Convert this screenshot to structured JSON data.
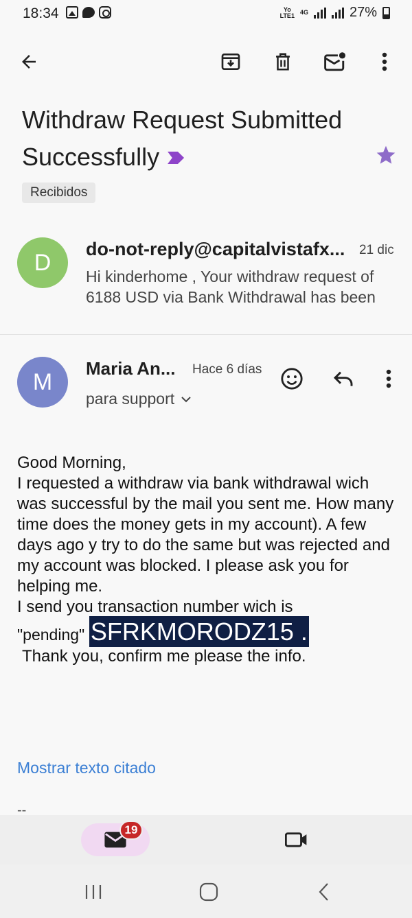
{
  "status_bar": {
    "time": "18:34",
    "network_top": "Yo",
    "network_bottom": "LTE1",
    "network_type": "4G",
    "battery": "27%",
    "notification_icons": [
      "photo-icon",
      "chat-icon",
      "instagram-icon"
    ]
  },
  "toolbar": {
    "icons": [
      "back-arrow-icon",
      "archive-icon",
      "trash-icon",
      "mark-unread-icon",
      "more-vert-icon"
    ]
  },
  "email": {
    "subject": "Withdraw Request Submitted Successfully",
    "label": "Recibidos",
    "starred": true,
    "star_color": "#8e6cc9",
    "important_color": "#8e44c9"
  },
  "message1": {
    "avatar_letter": "D",
    "avatar_color": "#8fc86a",
    "sender": "do-not-reply@capitalvistafx...",
    "date": "21 dic",
    "snippet": "Hi kinderhome , Your withdraw request of 6188 USD via Bank Withdrawal has been"
  },
  "message2": {
    "avatar_letter": "M",
    "avatar_color": "#7986cb",
    "sender": "Maria An...",
    "time": "Hace 6 días",
    "recipient": "para support",
    "body_lines": [
      "Good Morning,",
      "I requested a withdraw via bank withdrawal wich was successful by the mail you sent me. How many time does the money gets in my account). A few days ago y try to do the same but was rejected and my account was blocked. I please ask you for helping me.",
      "I send you transaction number wich is"
    ],
    "pending_label": "\"pending\"",
    "transaction_code": "SFRKMORODZ15 .",
    "thanks": "Thank you, confirm me please the info.",
    "show_quoted": "Mostrar texto citado",
    "signature": "--"
  },
  "bottom_nav": {
    "mail_badge": "19",
    "accent": "#f1d9f2"
  }
}
